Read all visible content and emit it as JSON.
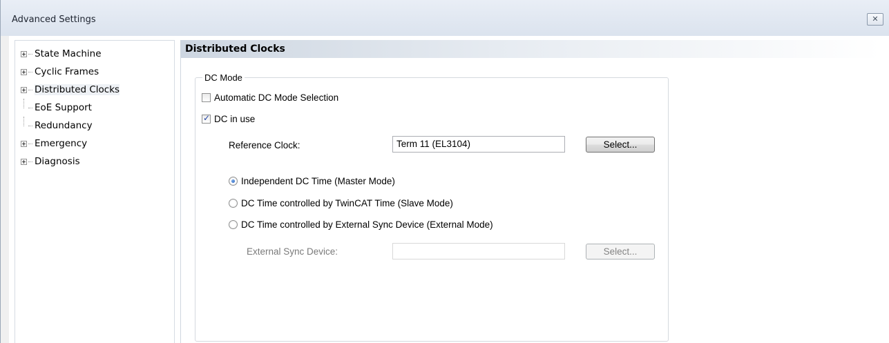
{
  "window": {
    "title": "Advanced Settings",
    "close_glyph": "☒"
  },
  "tree": {
    "items": [
      {
        "label": "State Machine",
        "expandable": true
      },
      {
        "label": "Cyclic Frames",
        "expandable": true
      },
      {
        "label": "Distributed Clocks",
        "expandable": true,
        "selected": true
      },
      {
        "label": "EoE Support",
        "expandable": false
      },
      {
        "label": "Redundancy",
        "expandable": false
      },
      {
        "label": "Emergency",
        "expandable": true
      },
      {
        "label": "Diagnosis",
        "expandable": true
      }
    ]
  },
  "content": {
    "header": "Distributed Clocks",
    "group_title": "DC Mode",
    "auto_dc_label": "Automatic DC Mode Selection",
    "auto_dc_checked": false,
    "dc_in_use_label": "DC in use",
    "dc_in_use_checked": true,
    "reference_clock_label": "Reference Clock:",
    "reference_clock_value": "Term 11 (EL3104)",
    "select_button_label": "Select...",
    "radio_options": [
      {
        "label": "Independent DC Time (Master Mode)",
        "checked": true
      },
      {
        "label": "DC Time controlled by TwinCAT Time (Slave Mode)",
        "checked": false
      },
      {
        "label": "DC Time controlled by External Sync Device (External Mode)",
        "checked": false
      }
    ],
    "external_sync_label": "External Sync Device:",
    "external_sync_value": "",
    "external_select_button_label": "Select..."
  }
}
